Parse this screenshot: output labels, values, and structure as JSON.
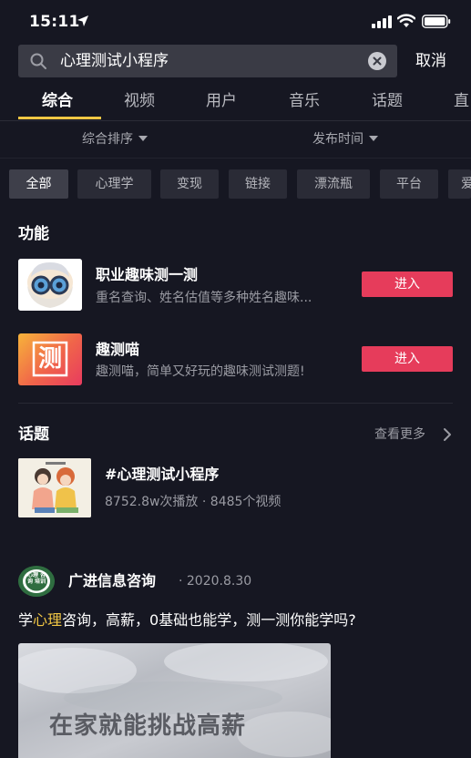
{
  "status": {
    "time": "15:11"
  },
  "search": {
    "query": "心理测试小程序",
    "cancel_label": "取消"
  },
  "tabs": [
    {
      "label": "综合",
      "active": true
    },
    {
      "label": "视频"
    },
    {
      "label": "用户"
    },
    {
      "label": "音乐"
    },
    {
      "label": "话题"
    },
    {
      "label": "直"
    }
  ],
  "sort": {
    "order_label": "综合排序",
    "time_label": "发布时间"
  },
  "chips": [
    "全部",
    "心理学",
    "变现",
    "链接",
    "漂流瓶",
    "平台",
    "爱"
  ],
  "functions": {
    "title": "功能",
    "items": [
      {
        "name": "职业趣味测一测",
        "desc": "重名查询、姓名估值等多种姓名趣味...",
        "button": "进入"
      },
      {
        "name": "趣测喵",
        "desc": "趣测喵，简单又好玩的趣味测试测题!",
        "button": "进入",
        "icon_char": "测"
      }
    ]
  },
  "topics": {
    "title": "话题",
    "more_label": "查看更多",
    "item": {
      "name": "#心理测试小程序",
      "stats": "8752.8w次播放 · 8485个视频"
    }
  },
  "post": {
    "avatar_text": "心理 咨询 培训",
    "author": "广进信息咨询",
    "date": "· 2020.8.30",
    "text_before": "学",
    "text_highlight": "心理",
    "text_after": "咨询，高薪，0基础也能学，测一测你能学吗?",
    "image_caption": "在家就能挑战高薪"
  },
  "colors": {
    "accent": "#f2c744",
    "button": "#e63c5b",
    "background": "#161722"
  }
}
